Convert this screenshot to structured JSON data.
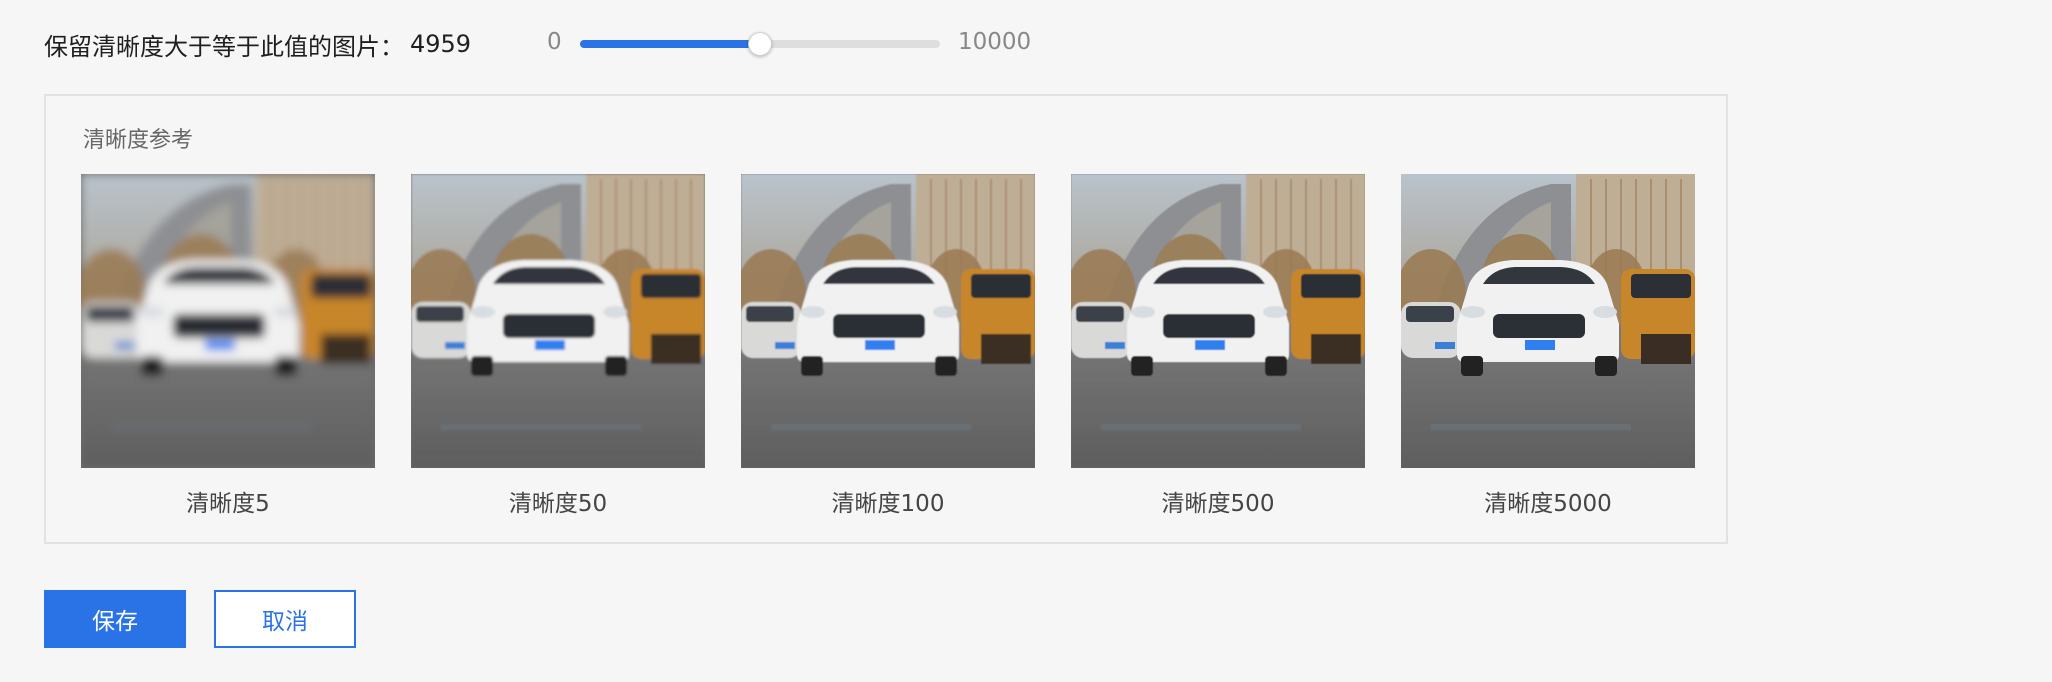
{
  "threshold": {
    "label": "保留清晰度大于等于此值的图片：",
    "value": "4959",
    "min": "0",
    "max": "10000",
    "fraction": 0.4959
  },
  "reference": {
    "title": "清晰度参考",
    "items": [
      {
        "caption": "清晰度5",
        "blur": 4.5
      },
      {
        "caption": "清晰度50",
        "blur": 1.4
      },
      {
        "caption": "清晰度100",
        "blur": 0.9
      },
      {
        "caption": "清晰度500",
        "blur": 0.5
      },
      {
        "caption": "清晰度5000",
        "blur": 0
      }
    ]
  },
  "actions": {
    "save": "保存",
    "cancel": "取消"
  },
  "colors": {
    "accent": "#2a73e6",
    "background": "#f6f6f6"
  }
}
